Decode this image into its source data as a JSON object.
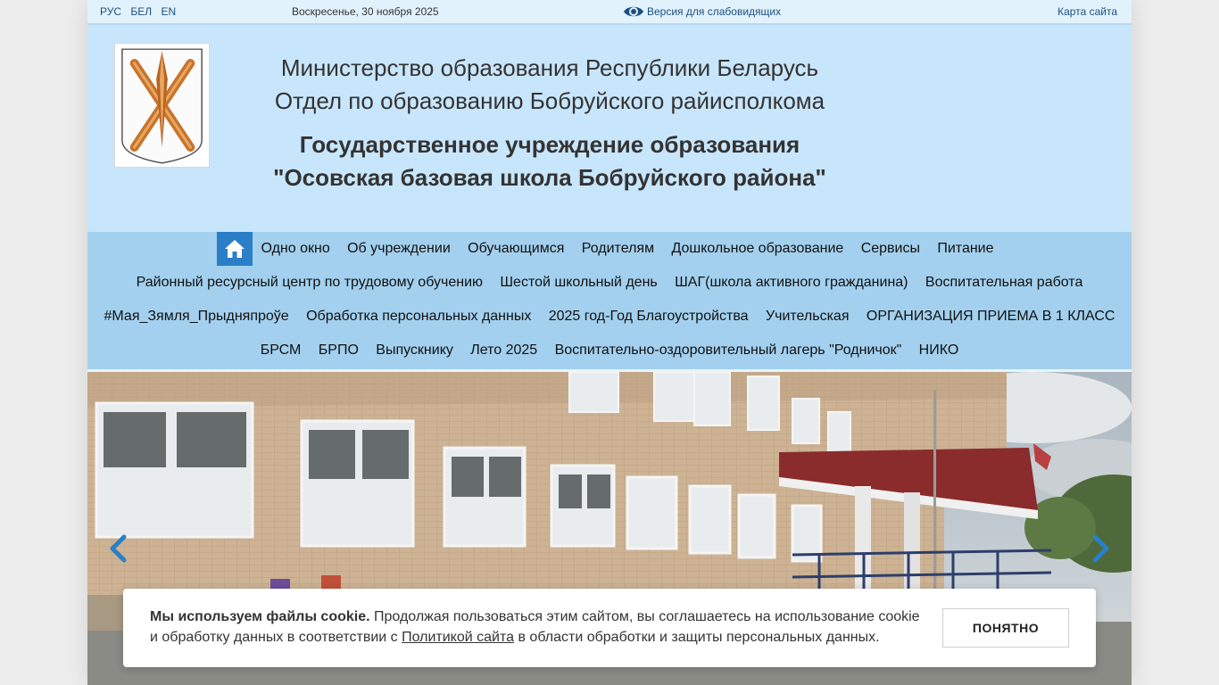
{
  "topbar": {
    "languages": [
      "РУС",
      "БЕЛ",
      "EN"
    ],
    "date": "Воскресенье, 30 ноября 2025",
    "accessibility_label": "Версия для слабовидящих",
    "sitemap_label": "Карта сайта"
  },
  "header": {
    "line1": "Министерство образования Республики Беларусь",
    "line2": "Отдел по образованию Бобруйского райисполкома",
    "line3": "Государственное учреждение образования",
    "line4": "\"Осовская базовая школа Бобруйского района\""
  },
  "nav": {
    "row1": [
      "Одно окно",
      "Об учреждении",
      "Обучающимся",
      "Родителям",
      "Дошкольное образование",
      "Сервисы",
      "Питание"
    ],
    "row2": [
      "Районный ресурсный центр по трудовому обучению",
      "Шестой школьный день",
      "ШАГ(школа активного гражданина)",
      "Воспитательная работа"
    ],
    "row3": [
      "#Мая_Зямля_Прыдняпроўе",
      "Обработка персональных данных",
      "2025 год-Год Благоустройства",
      "Учительская",
      "ОРГАНИЗАЦИЯ ПРИЕМА В 1 КЛАСС"
    ],
    "row4": [
      "БРСМ",
      "БРПО",
      "Выпускнику",
      "Лето 2025",
      "Воспитательно-оздоровительный лагерь \"Родничок\"",
      "НИКО"
    ]
  },
  "cookie": {
    "bold": "Мы используем файлы cookie.",
    "text1": " Продолжая пользоваться этим сайтом, вы соглашаетесь на использование cookie и обработку данных в соответствии с ",
    "link": "Политикой сайта",
    "text2": " в области обработки и защиты персональных данных.",
    "button": "ПОНЯТНО"
  },
  "colors": {
    "header_bg": "#c8e6fb",
    "nav_bg": "#a3d0ee",
    "home_button": "#2a7fc6",
    "link": "#1a4f80"
  },
  "icons": {
    "home": "home-icon",
    "eye": "eye-icon",
    "prev": "chevron-left-icon",
    "next": "chevron-right-icon"
  }
}
